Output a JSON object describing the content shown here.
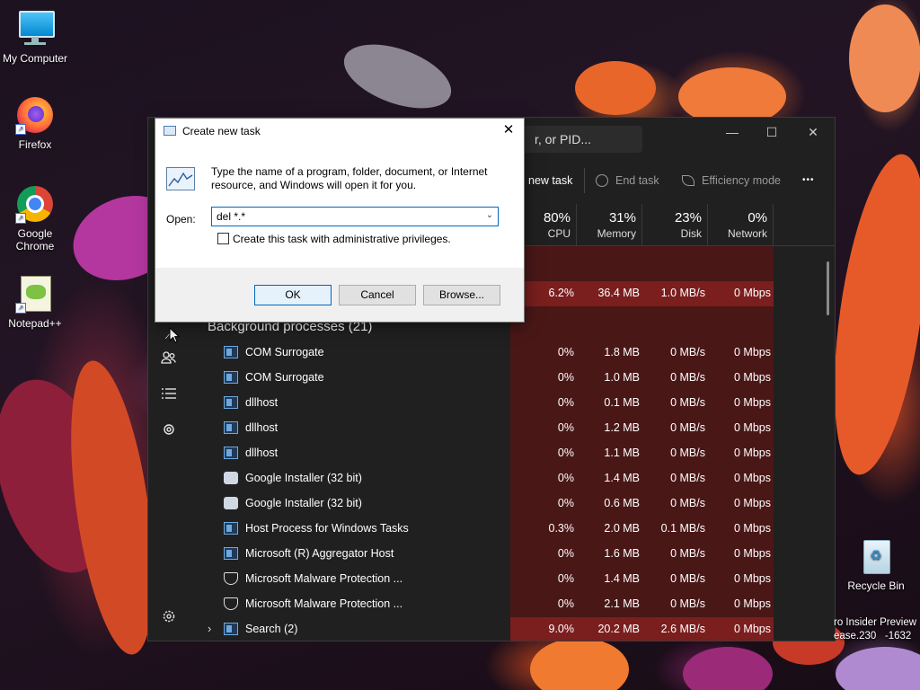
{
  "desktop": {
    "icons": [
      {
        "label": "My Computer",
        "icon": "monitor-icon"
      },
      {
        "label": "Firefox",
        "icon": "firefox-icon"
      },
      {
        "label": "Google Chrome",
        "icon": "chrome-icon"
      },
      {
        "label": "Notepad++",
        "icon": "notepadpp-icon"
      },
      {
        "label": "Recycle Bin",
        "icon": "recycle-bin-icon"
      }
    ],
    "watermark_line1": "ro Insider Preview",
    "watermark_line2": "ease.230   -1632"
  },
  "task_manager": {
    "search_placeholder": "r, or PID...",
    "toolbar": {
      "run_new_task": "new task",
      "end_task": "End task",
      "efficiency_mode": "Efficiency mode",
      "more": "•••"
    },
    "columns": [
      {
        "pct": "80%",
        "label": "CPU"
      },
      {
        "pct": "31%",
        "label": "Memory"
      },
      {
        "pct": "23%",
        "label": "Disk"
      },
      {
        "pct": "0%",
        "label": "Network"
      }
    ],
    "top_row": {
      "cpu": "6.2%",
      "memory": "36.4 MB",
      "disk": "1.0 MB/s",
      "network": "0 Mbps"
    },
    "background_group_title": "Background processes (21)",
    "processes": [
      {
        "name": "COM Surrogate",
        "icon": "box",
        "cpu": "0%",
        "memory": "1.8 MB",
        "disk": "0 MB/s",
        "network": "0 Mbps"
      },
      {
        "name": "COM Surrogate",
        "icon": "box",
        "cpu": "0%",
        "memory": "1.0 MB",
        "disk": "0 MB/s",
        "network": "0 Mbps"
      },
      {
        "name": "dllhost",
        "icon": "box",
        "cpu": "0%",
        "memory": "0.1 MB",
        "disk": "0 MB/s",
        "network": "0 Mbps"
      },
      {
        "name": "dllhost",
        "icon": "box",
        "cpu": "0%",
        "memory": "1.2 MB",
        "disk": "0 MB/s",
        "network": "0 Mbps"
      },
      {
        "name": "dllhost",
        "icon": "box",
        "cpu": "0%",
        "memory": "1.1 MB",
        "disk": "0 MB/s",
        "network": "0 Mbps"
      },
      {
        "name": "Google Installer (32 bit)",
        "icon": "ginst",
        "cpu": "0%",
        "memory": "1.4 MB",
        "disk": "0 MB/s",
        "network": "0 Mbps"
      },
      {
        "name": "Google Installer (32 bit)",
        "icon": "ginst",
        "cpu": "0%",
        "memory": "0.6 MB",
        "disk": "0 MB/s",
        "network": "0 Mbps"
      },
      {
        "name": "Host Process for Windows Tasks",
        "icon": "box",
        "cpu": "0.3%",
        "memory": "2.0 MB",
        "disk": "0.1 MB/s",
        "network": "0 Mbps"
      },
      {
        "name": "Microsoft (R) Aggregator Host",
        "icon": "box",
        "cpu": "0%",
        "memory": "1.6 MB",
        "disk": "0 MB/s",
        "network": "0 Mbps"
      },
      {
        "name": "Microsoft Malware Protection ...",
        "icon": "shield",
        "cpu": "0%",
        "memory": "1.4 MB",
        "disk": "0 MB/s",
        "network": "0 Mbps"
      },
      {
        "name": "Microsoft Malware Protection ...",
        "icon": "shield",
        "cpu": "0%",
        "memory": "2.1 MB",
        "disk": "0 MB/s",
        "network": "0 Mbps"
      },
      {
        "name": "Search (2)",
        "icon": "box",
        "cpu": "9.0%",
        "memory": "20.2 MB",
        "disk": "2.6 MB/s",
        "network": "0 Mbps"
      }
    ]
  },
  "dialog": {
    "title": "Create new task",
    "close": "✕",
    "description": "Type the name of a program, folder, document, or Internet resource, and Windows will open it for you.",
    "open_label": "Open:",
    "open_value": "del *.*",
    "admin_checkbox_label": "Create this task with administrative privileges.",
    "ok": "OK",
    "cancel": "Cancel",
    "browse": "Browse..."
  }
}
